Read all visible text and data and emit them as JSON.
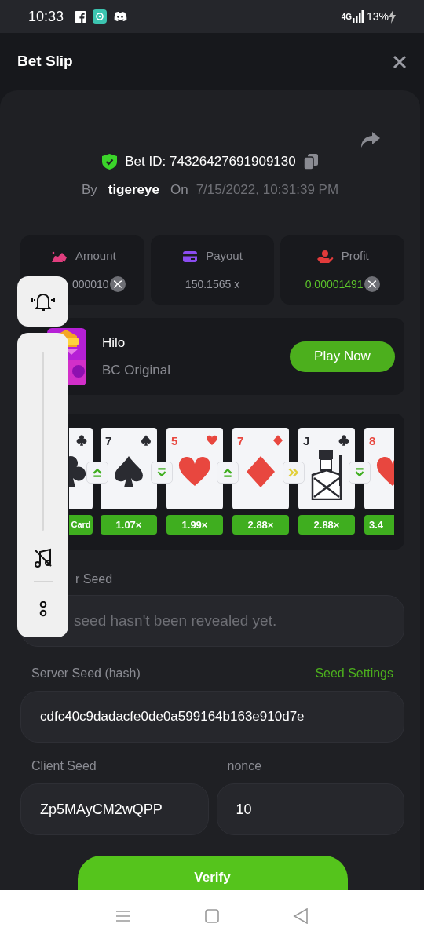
{
  "status_bar": {
    "time": "10:33",
    "network": "4G",
    "battery": "13%"
  },
  "header": {
    "title": "Bet Slip"
  },
  "bet": {
    "id_text": "Bet ID: 74326427691909130",
    "by_label": "By",
    "user": "tigereye",
    "on_label": "On",
    "date": "7/15/2022, 10:31:39 PM"
  },
  "stats": [
    {
      "kind": "amount",
      "label": "Amount",
      "value": "000010",
      "coin": true
    },
    {
      "kind": "payout",
      "label": "Payout",
      "value": "150.1565 x",
      "coin": false
    },
    {
      "kind": "profit",
      "label": "Profit",
      "value": "0.00001491",
      "coin": true
    }
  ],
  "game": {
    "name": "Hilo",
    "provider": "BC Original",
    "button": "Play Now"
  },
  "cards": [
    {
      "kind": "clubs",
      "label": "Card"
    },
    {
      "kind": "spades",
      "rank": "7",
      "label": "1.07×"
    },
    {
      "kind": "hearts",
      "rank": "5",
      "label": "1.99×"
    },
    {
      "kind": "diamonds",
      "rank": "7",
      "label": "2.88×"
    },
    {
      "kind": "clubs",
      "rank": "J",
      "label": "2.88×"
    },
    {
      "kind": "hearts",
      "rank": "8",
      "label": "3.4"
    }
  ],
  "transitions": [
    {
      "kind": "higher"
    },
    {
      "kind": "lower"
    },
    {
      "kind": "higher"
    },
    {
      "kind": "skip"
    },
    {
      "kind": "lower"
    }
  ],
  "server_seed": {
    "label": "r Seed",
    "placeholder": "seed hasn't been revealed yet."
  },
  "server_seed_hash": {
    "label": "Server Seed (hash)",
    "link": "Seed Settings",
    "value": "cdfc40c9dadacfe0de0a599164b163e910d7e"
  },
  "client_seed": {
    "label": "Client Seed",
    "value": "Zp5MAyCM2wQPP"
  },
  "nonce": {
    "label": "nonce",
    "value": "10"
  },
  "verify_button": "Verify"
}
